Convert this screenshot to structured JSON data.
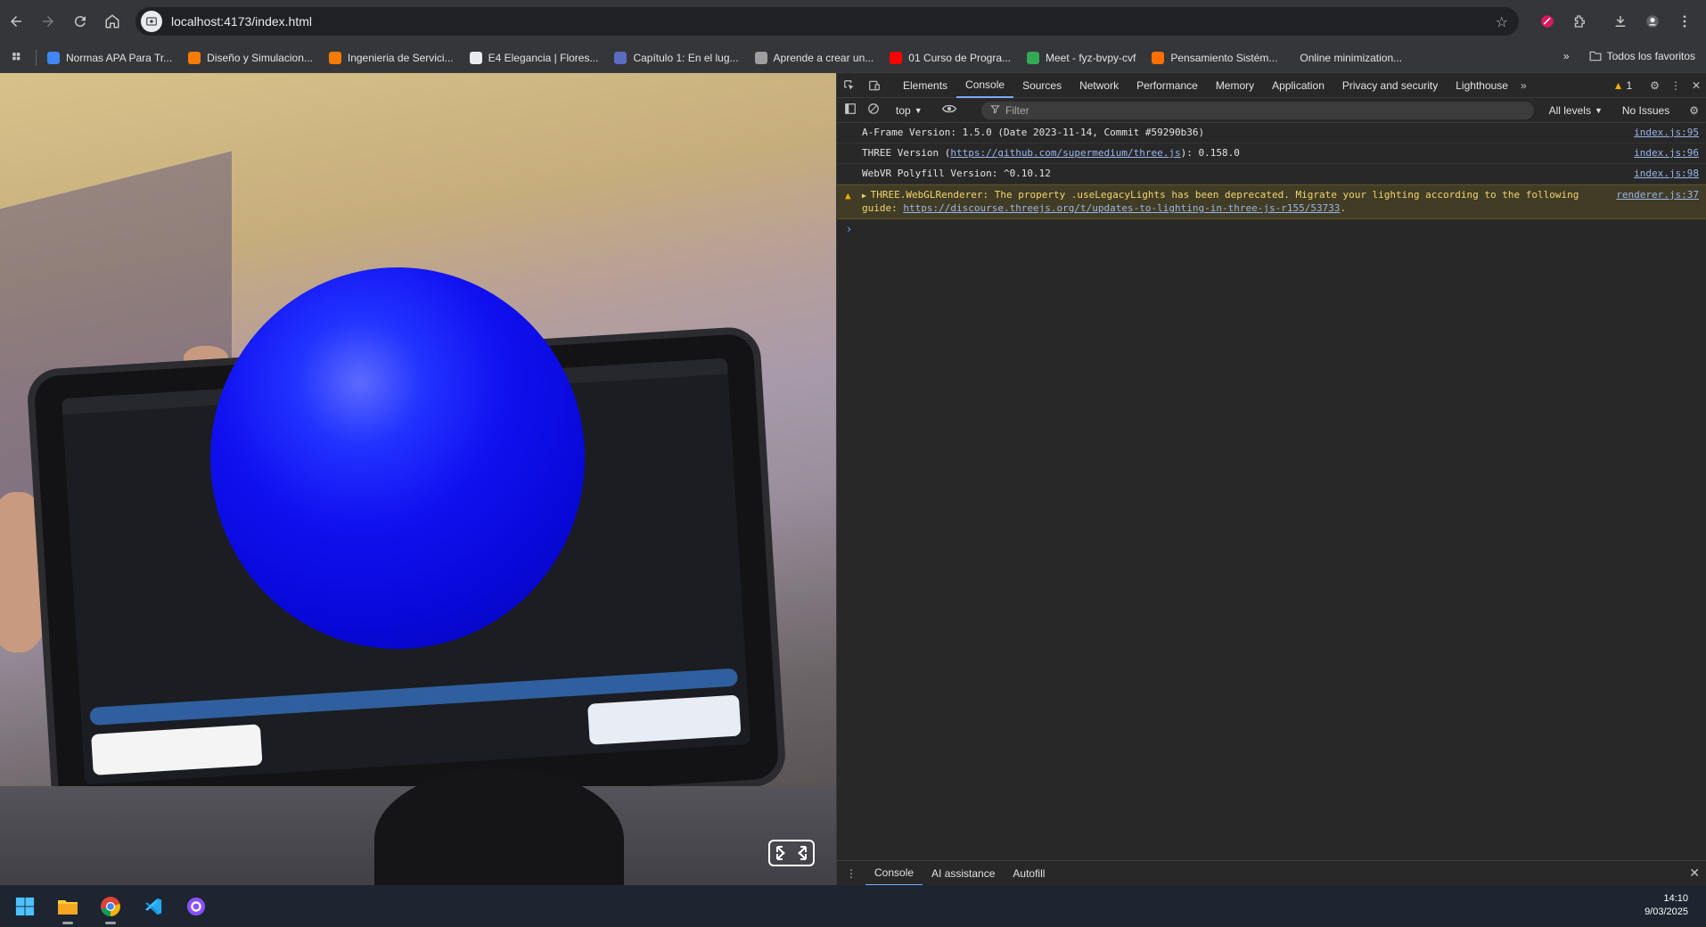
{
  "browser": {
    "url": "localhost:4173/index.html",
    "bookmarks": [
      {
        "label": "Normas APA Para Tr...",
        "color": "#4285f4"
      },
      {
        "label": "Diseño y Simulacion...",
        "color": "#f57c00"
      },
      {
        "label": "Ingenieria de Servici...",
        "color": "#f57c00"
      },
      {
        "label": "E4 Elegancia | Flores...",
        "color": "#e8eaed"
      },
      {
        "label": "Capítulo 1: En el lug...",
        "color": "#5c6bc0"
      },
      {
        "label": "Aprende a crear un...",
        "color": "#9e9e9e"
      },
      {
        "label": "01 Curso de Progra...",
        "color": "#ff0000"
      },
      {
        "label": "Meet - fyz-bvpy-cvf",
        "color": "#34a853"
      },
      {
        "label": "Pensamiento Sistém...",
        "color": "#ff6f00"
      },
      {
        "label": "Online minimization...",
        "color": ""
      }
    ],
    "all_bookmarks_label": "Todos los favoritos"
  },
  "scene": {
    "sphere_color": "#0000ff"
  },
  "devtools": {
    "tabs": [
      "Elements",
      "Console",
      "Sources",
      "Network",
      "Performance",
      "Memory",
      "Application",
      "Privacy and security",
      "Lighthouse"
    ],
    "active_tab": "Console",
    "warning_count": "1",
    "context": "top",
    "filter_placeholder": "Filter",
    "levels": "All levels",
    "issues": "No Issues",
    "messages": [
      {
        "type": "log",
        "text": "A-Frame Version: 1.5.0 (Date 2023-11-14, Commit #59290b36)",
        "source": "index.js:95"
      },
      {
        "type": "log",
        "text_before": "THREE Version (",
        "link": "https://github.com/supermedium/three.js",
        "text_after": "): 0.158.0",
        "source": "index.js:96"
      },
      {
        "type": "log",
        "text": "WebVR Polyfill Version: ^0.10.12",
        "source": "index.js:98"
      },
      {
        "type": "warning",
        "text": "THREE.WebGLRenderer: The property .useLegacyLights has been deprecated. Migrate your lighting according to the following guide: ",
        "link": "https://discourse.threejs.org/t/updates-to-lighting-in-three-js-r155/53733",
        "text_after": ".",
        "source": "renderer.js:37"
      }
    ],
    "drawer_tabs": [
      "Console",
      "AI assistance",
      "Autofill"
    ]
  },
  "taskbar": {
    "time": "14:10",
    "date": "9/03/2025"
  }
}
